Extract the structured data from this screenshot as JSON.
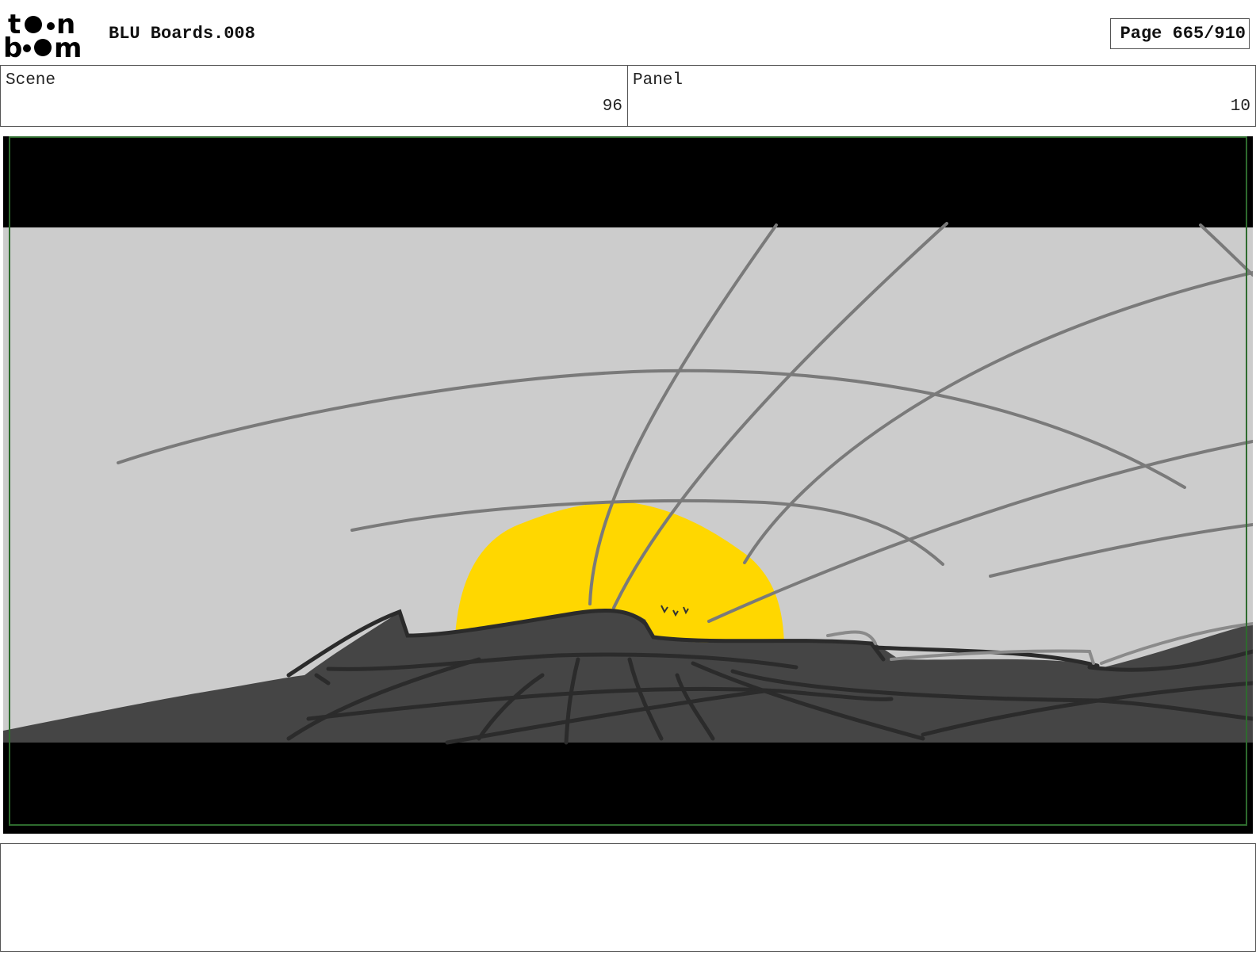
{
  "header": {
    "logo": {
      "text": "toon boom"
    },
    "document_title": "BLU Boards.008",
    "page_indicator": "Page 665/910"
  },
  "info": {
    "scene": {
      "label": "Scene",
      "value": "96"
    },
    "panel": {
      "label": "Panel",
      "value": "10"
    }
  },
  "frame": {
    "colors": {
      "sky": "#cccccc",
      "sun": "#ffd700",
      "ground": "#454545",
      "letterbox": "#000000",
      "safe_border": "#2e6b2e"
    }
  },
  "notes": {
    "text": ""
  }
}
